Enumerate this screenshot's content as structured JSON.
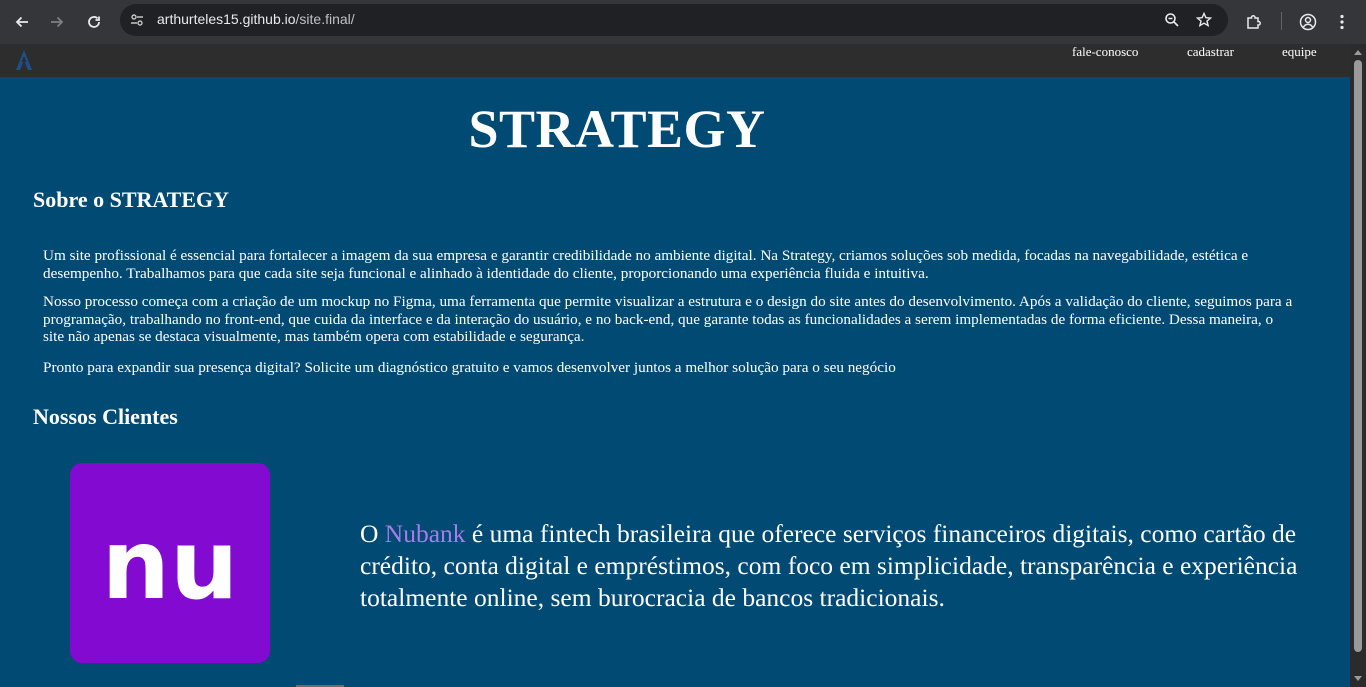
{
  "browser": {
    "url_host": "arthurteles15.github.io",
    "url_path": "/site.final/",
    "icons": {
      "back": "arrow-left-icon",
      "forward": "arrow-right-icon",
      "reload": "reload-icon",
      "site_info": "tune-icon",
      "zoom": "zoom-icon",
      "bookmark": "star-icon",
      "extensions": "puzzle-icon",
      "profile": "profile-icon",
      "menu": "kebab-menu-icon"
    }
  },
  "site": {
    "nav": {
      "contact": "fale-conosco",
      "register": "cadastrar",
      "team": "equipe"
    },
    "hero_title": "STRATEGY",
    "about": {
      "heading": "Sobre o STRATEGY",
      "p1": "Um site profissional é essencial para fortalecer a imagem da sua empresa e garantir credibilidade no ambiente digital. Na Strategy, criamos soluções sob medida, focadas na navegabilidade, estética e desempenho. Trabalhamos para que cada site seja funcional e alinhado à identidade do cliente, proporcionando uma experiência fluida e intuitiva.",
      "p2": "Nosso processo começa com a criação de um mockup no Figma, uma ferramenta que permite visualizar a estrutura e o design do site antes do desenvolvimento. Após a validação do cliente, seguimos para a programação, trabalhando no front-end, que cuida da interface e da interação do usuário, e no back-end, que garante todas as funcionalidades a serem implementadas de forma eficiente. Dessa maneira, o site não apenas se destaca visualmente, mas também opera com estabilidade e segurança.",
      "p3": "Pronto para expandir sua presença digital? Solicite um diagnóstico gratuito e vamos desenvolver juntos a melhor solução para o seu negócio"
    },
    "clients": {
      "heading": "Nossos Clientes",
      "client1": {
        "text_prefix": "O ",
        "brand": "Nubank",
        "text_rest": " é uma fintech brasileira que oferece serviços financeiros digitais, como cartão de crédito, conta digital e empréstimos, com foco em simplicidade, transparência e experiência totalmente online, sem burocracia de bancos tradicionais.",
        "logo_text": "nu",
        "logo_color": "#820ad1"
      }
    },
    "colors": {
      "page_bg": "#004a73",
      "header_bg": "#2d2d2d",
      "brand_link": "#a77be8"
    }
  }
}
